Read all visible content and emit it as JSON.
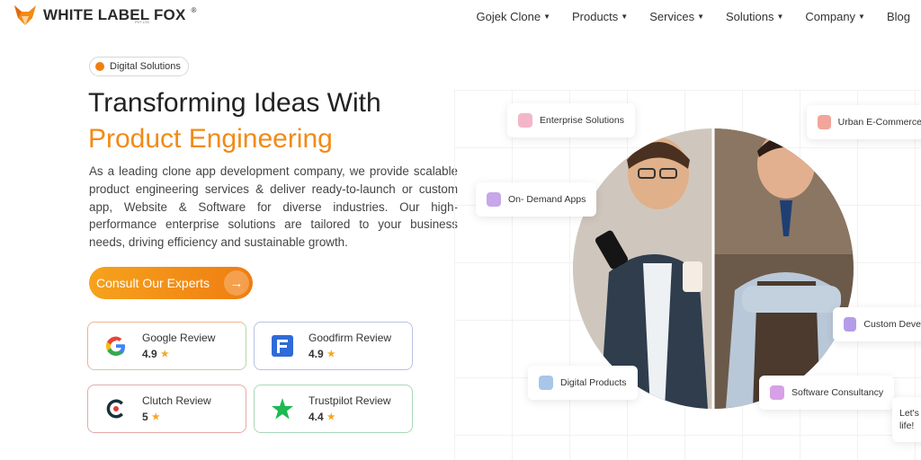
{
  "brand": {
    "name": "WHITE LABEL FOX",
    "registered": "®",
    "sub": "PVT LTD"
  },
  "nav": {
    "items": [
      {
        "label": "Gojek Clone",
        "dropdown": true
      },
      {
        "label": "Products",
        "dropdown": true
      },
      {
        "label": "Services",
        "dropdown": true
      },
      {
        "label": "Solutions",
        "dropdown": true
      },
      {
        "label": "Company",
        "dropdown": true
      },
      {
        "label": "Blog",
        "dropdown": false
      }
    ]
  },
  "hero": {
    "pill": "Digital Solutions",
    "title_line1": "Transforming Ideas With",
    "title_line2": "Product Engineering",
    "description": "As a leading clone app development company, we provide scalable product engineering services & deliver ready-to-launch or custom app, Website & Software for diverse industries. Our high-performance enterprise solutions are tailored to your business needs, driving efficiency and sustainable growth.",
    "cta": "Consult Our Experts"
  },
  "reviews": [
    {
      "name": "Google Review",
      "score": "4.9"
    },
    {
      "name": "Goodfirm Review",
      "score": "4.9"
    },
    {
      "name": "Clutch Review",
      "score": "5"
    },
    {
      "name": "Trustpilot Review",
      "score": "4.4"
    }
  ],
  "chips": {
    "enterprise": "Enterprise Solutions",
    "urban": "Urban E-Commerce",
    "ondemand": "On- Demand Apps",
    "custom": "Custom Deve",
    "digital": "Digital Products",
    "software": "Software Consultancy",
    "chat_line1": "Let's",
    "chat_line2": "life!"
  },
  "colors": {
    "accent": "#f28a16",
    "text": "#222222"
  }
}
